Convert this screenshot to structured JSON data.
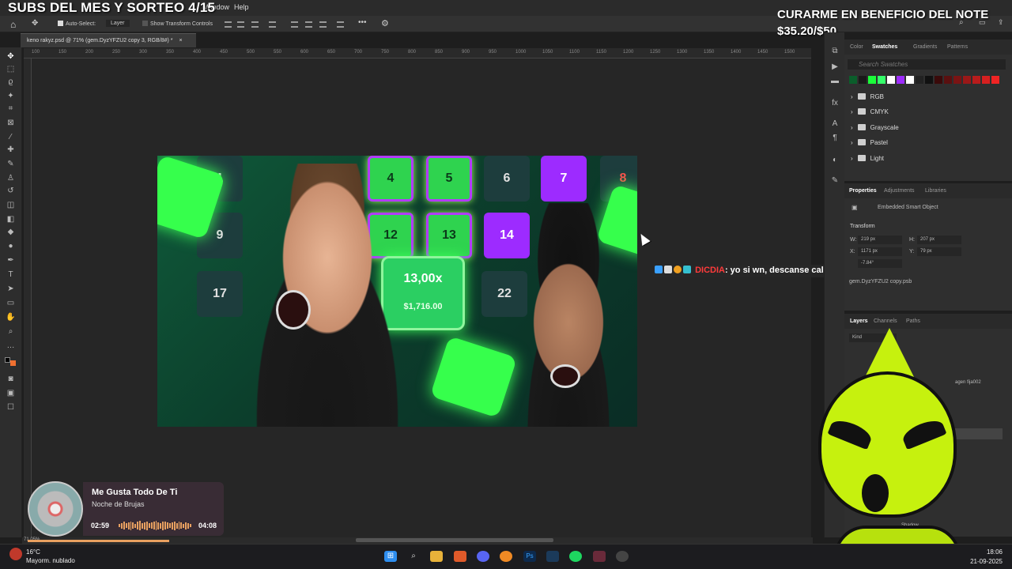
{
  "overlay": {
    "title": "SUBS DEL MES Y SORTEO 4/15",
    "goal_line1": "CURARME EN BENEFICIO DEL NOTE",
    "goal_line2": "$35.20/$50"
  },
  "menubar": {
    "window": "Window",
    "help": "Help"
  },
  "options_bar": {
    "auto_select": "Auto-Select:",
    "layer": "Layer",
    "show_transform": "Show Transform Controls",
    "more": "•••"
  },
  "document_tab": {
    "title": "keno rakyz.psd @ 71% (gem.DyzYFZU2 copy 3, RGB/8#) *",
    "close": "×"
  },
  "ruler_ticks": [
    "100",
    "150",
    "200",
    "250",
    "300",
    "350",
    "400",
    "450",
    "500",
    "550",
    "600",
    "650",
    "700",
    "750",
    "800",
    "850",
    "900",
    "950",
    "1000",
    "1050",
    "1100",
    "1150",
    "1200",
    "1250",
    "1300",
    "1350",
    "1400",
    "1450",
    "1500"
  ],
  "artwork": {
    "tiles": [
      "1",
      "4",
      "5",
      "6",
      "7",
      "8",
      "9",
      "12",
      "13",
      "14",
      "17",
      "22"
    ],
    "multiplier": "13,00x",
    "amount": "$1,716.00"
  },
  "chat": {
    "user": "DICDIA",
    "message": ": yo si wn, descanse caleta"
  },
  "panels": {
    "swatch_tabs": [
      "Color",
      "Swatches",
      "Gradients",
      "Patterns"
    ],
    "swatch_search_placeholder": "Search Swatches",
    "swatch_groups": [
      "RGB",
      "CMYK",
      "Grayscale",
      "Pastel",
      "Light"
    ],
    "swatch_colors": [
      "#0b5e2b",
      "#1a1a1a",
      "#1aff3a",
      "#35ff6a",
      "#ffffff",
      "#9d2bff",
      "#ffffff",
      "#222222",
      "#111111",
      "#3a0a0a",
      "#5a1010",
      "#7a1414",
      "#9a1818",
      "#b81c1c",
      "#d62020",
      "#f02424"
    ],
    "props_tabs": [
      "Properties",
      "Adjustments",
      "Libraries"
    ],
    "embedded": "Embedded Smart Object",
    "transform": "Transform",
    "w_label": "W:",
    "w_value": "219 px",
    "h_label": "H:",
    "h_value": "207 px",
    "x_label": "X:",
    "x_value": "1171 px",
    "y_label": "Y:",
    "y_value": "79 px",
    "angle_value": "-7.84°",
    "file_name": "gem.DyzYFZU2 copy.psb",
    "layers_tabs": [
      "Layers",
      "Channels",
      "Paths"
    ],
    "kind": "Kind",
    "layer_name_partial": "agen fija002",
    "shadow_partial": "Shadow"
  },
  "music": {
    "title": "Me Gusta Todo De Ti",
    "artist": "Noche de Brujas",
    "elapsed": "02:59",
    "total": "04:08",
    "progress": 0.72,
    "status_bar_text": "71.05%"
  },
  "taskbar": {
    "weather_temp": "16°C",
    "weather_desc": "Mayorm. nublado",
    "time": "18:06",
    "date": "21-09-2025"
  },
  "colors": {
    "accent_green": "#2fd34f",
    "accent_purple": "#9d2bff",
    "chat_user": "#ff3b3b",
    "music_accent": "#e8a060",
    "mascot": "#c6f10e"
  }
}
